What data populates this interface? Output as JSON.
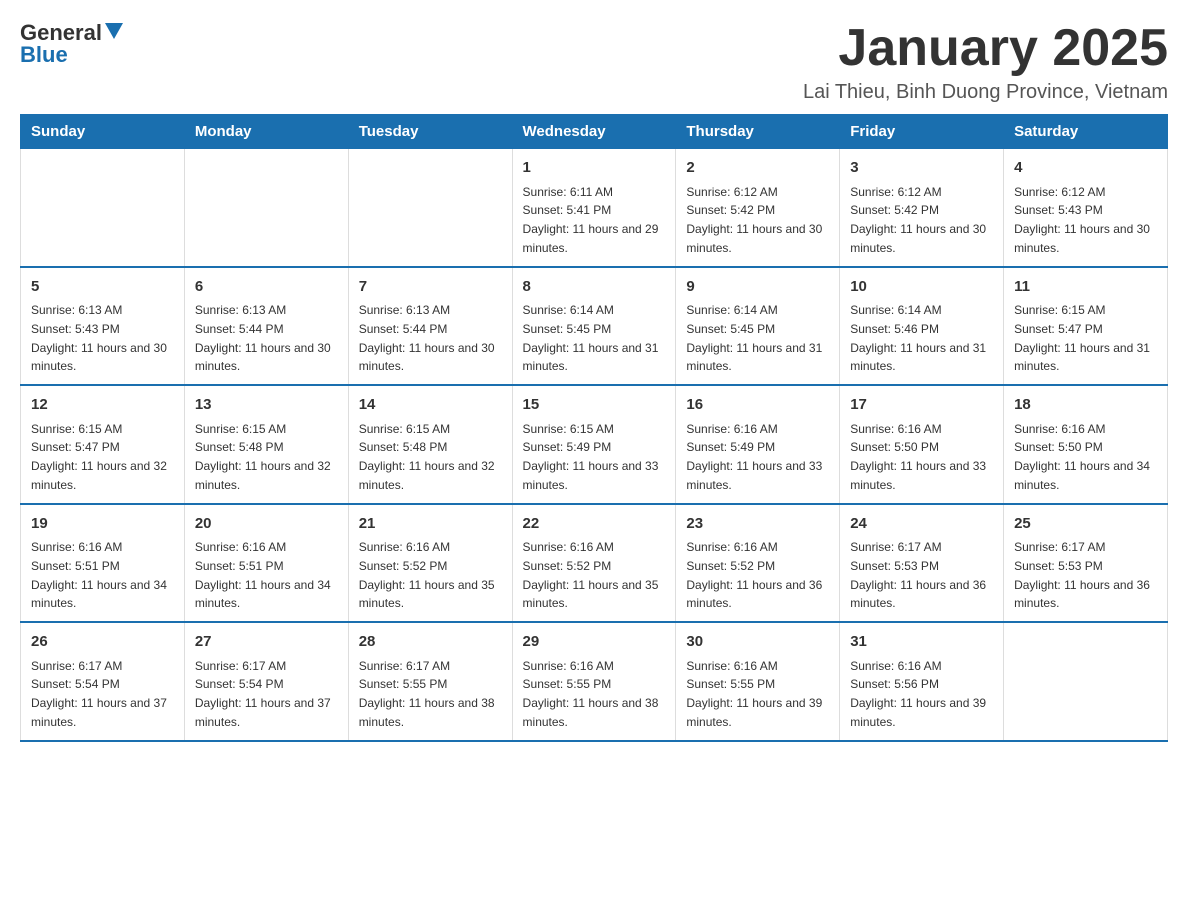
{
  "logo": {
    "text_general": "General",
    "text_blue": "Blue"
  },
  "title": "January 2025",
  "subtitle": "Lai Thieu, Binh Duong Province, Vietnam",
  "days_of_week": [
    "Sunday",
    "Monday",
    "Tuesday",
    "Wednesday",
    "Thursday",
    "Friday",
    "Saturday"
  ],
  "weeks": [
    [
      {
        "day": "",
        "sunrise": "",
        "sunset": "",
        "daylight": ""
      },
      {
        "day": "",
        "sunrise": "",
        "sunset": "",
        "daylight": ""
      },
      {
        "day": "",
        "sunrise": "",
        "sunset": "",
        "daylight": ""
      },
      {
        "day": "1",
        "sunrise": "Sunrise: 6:11 AM",
        "sunset": "Sunset: 5:41 PM",
        "daylight": "Daylight: 11 hours and 29 minutes."
      },
      {
        "day": "2",
        "sunrise": "Sunrise: 6:12 AM",
        "sunset": "Sunset: 5:42 PM",
        "daylight": "Daylight: 11 hours and 30 minutes."
      },
      {
        "day": "3",
        "sunrise": "Sunrise: 6:12 AM",
        "sunset": "Sunset: 5:42 PM",
        "daylight": "Daylight: 11 hours and 30 minutes."
      },
      {
        "day": "4",
        "sunrise": "Sunrise: 6:12 AM",
        "sunset": "Sunset: 5:43 PM",
        "daylight": "Daylight: 11 hours and 30 minutes."
      }
    ],
    [
      {
        "day": "5",
        "sunrise": "Sunrise: 6:13 AM",
        "sunset": "Sunset: 5:43 PM",
        "daylight": "Daylight: 11 hours and 30 minutes."
      },
      {
        "day": "6",
        "sunrise": "Sunrise: 6:13 AM",
        "sunset": "Sunset: 5:44 PM",
        "daylight": "Daylight: 11 hours and 30 minutes."
      },
      {
        "day": "7",
        "sunrise": "Sunrise: 6:13 AM",
        "sunset": "Sunset: 5:44 PM",
        "daylight": "Daylight: 11 hours and 30 minutes."
      },
      {
        "day": "8",
        "sunrise": "Sunrise: 6:14 AM",
        "sunset": "Sunset: 5:45 PM",
        "daylight": "Daylight: 11 hours and 31 minutes."
      },
      {
        "day": "9",
        "sunrise": "Sunrise: 6:14 AM",
        "sunset": "Sunset: 5:45 PM",
        "daylight": "Daylight: 11 hours and 31 minutes."
      },
      {
        "day": "10",
        "sunrise": "Sunrise: 6:14 AM",
        "sunset": "Sunset: 5:46 PM",
        "daylight": "Daylight: 11 hours and 31 minutes."
      },
      {
        "day": "11",
        "sunrise": "Sunrise: 6:15 AM",
        "sunset": "Sunset: 5:47 PM",
        "daylight": "Daylight: 11 hours and 31 minutes."
      }
    ],
    [
      {
        "day": "12",
        "sunrise": "Sunrise: 6:15 AM",
        "sunset": "Sunset: 5:47 PM",
        "daylight": "Daylight: 11 hours and 32 minutes."
      },
      {
        "day": "13",
        "sunrise": "Sunrise: 6:15 AM",
        "sunset": "Sunset: 5:48 PM",
        "daylight": "Daylight: 11 hours and 32 minutes."
      },
      {
        "day": "14",
        "sunrise": "Sunrise: 6:15 AM",
        "sunset": "Sunset: 5:48 PM",
        "daylight": "Daylight: 11 hours and 32 minutes."
      },
      {
        "day": "15",
        "sunrise": "Sunrise: 6:15 AM",
        "sunset": "Sunset: 5:49 PM",
        "daylight": "Daylight: 11 hours and 33 minutes."
      },
      {
        "day": "16",
        "sunrise": "Sunrise: 6:16 AM",
        "sunset": "Sunset: 5:49 PM",
        "daylight": "Daylight: 11 hours and 33 minutes."
      },
      {
        "day": "17",
        "sunrise": "Sunrise: 6:16 AM",
        "sunset": "Sunset: 5:50 PM",
        "daylight": "Daylight: 11 hours and 33 minutes."
      },
      {
        "day": "18",
        "sunrise": "Sunrise: 6:16 AM",
        "sunset": "Sunset: 5:50 PM",
        "daylight": "Daylight: 11 hours and 34 minutes."
      }
    ],
    [
      {
        "day": "19",
        "sunrise": "Sunrise: 6:16 AM",
        "sunset": "Sunset: 5:51 PM",
        "daylight": "Daylight: 11 hours and 34 minutes."
      },
      {
        "day": "20",
        "sunrise": "Sunrise: 6:16 AM",
        "sunset": "Sunset: 5:51 PM",
        "daylight": "Daylight: 11 hours and 34 minutes."
      },
      {
        "day": "21",
        "sunrise": "Sunrise: 6:16 AM",
        "sunset": "Sunset: 5:52 PM",
        "daylight": "Daylight: 11 hours and 35 minutes."
      },
      {
        "day": "22",
        "sunrise": "Sunrise: 6:16 AM",
        "sunset": "Sunset: 5:52 PM",
        "daylight": "Daylight: 11 hours and 35 minutes."
      },
      {
        "day": "23",
        "sunrise": "Sunrise: 6:16 AM",
        "sunset": "Sunset: 5:52 PM",
        "daylight": "Daylight: 11 hours and 36 minutes."
      },
      {
        "day": "24",
        "sunrise": "Sunrise: 6:17 AM",
        "sunset": "Sunset: 5:53 PM",
        "daylight": "Daylight: 11 hours and 36 minutes."
      },
      {
        "day": "25",
        "sunrise": "Sunrise: 6:17 AM",
        "sunset": "Sunset: 5:53 PM",
        "daylight": "Daylight: 11 hours and 36 minutes."
      }
    ],
    [
      {
        "day": "26",
        "sunrise": "Sunrise: 6:17 AM",
        "sunset": "Sunset: 5:54 PM",
        "daylight": "Daylight: 11 hours and 37 minutes."
      },
      {
        "day": "27",
        "sunrise": "Sunrise: 6:17 AM",
        "sunset": "Sunset: 5:54 PM",
        "daylight": "Daylight: 11 hours and 37 minutes."
      },
      {
        "day": "28",
        "sunrise": "Sunrise: 6:17 AM",
        "sunset": "Sunset: 5:55 PM",
        "daylight": "Daylight: 11 hours and 38 minutes."
      },
      {
        "day": "29",
        "sunrise": "Sunrise: 6:16 AM",
        "sunset": "Sunset: 5:55 PM",
        "daylight": "Daylight: 11 hours and 38 minutes."
      },
      {
        "day": "30",
        "sunrise": "Sunrise: 6:16 AM",
        "sunset": "Sunset: 5:55 PM",
        "daylight": "Daylight: 11 hours and 39 minutes."
      },
      {
        "day": "31",
        "sunrise": "Sunrise: 6:16 AM",
        "sunset": "Sunset: 5:56 PM",
        "daylight": "Daylight: 11 hours and 39 minutes."
      },
      {
        "day": "",
        "sunrise": "",
        "sunset": "",
        "daylight": ""
      }
    ]
  ]
}
